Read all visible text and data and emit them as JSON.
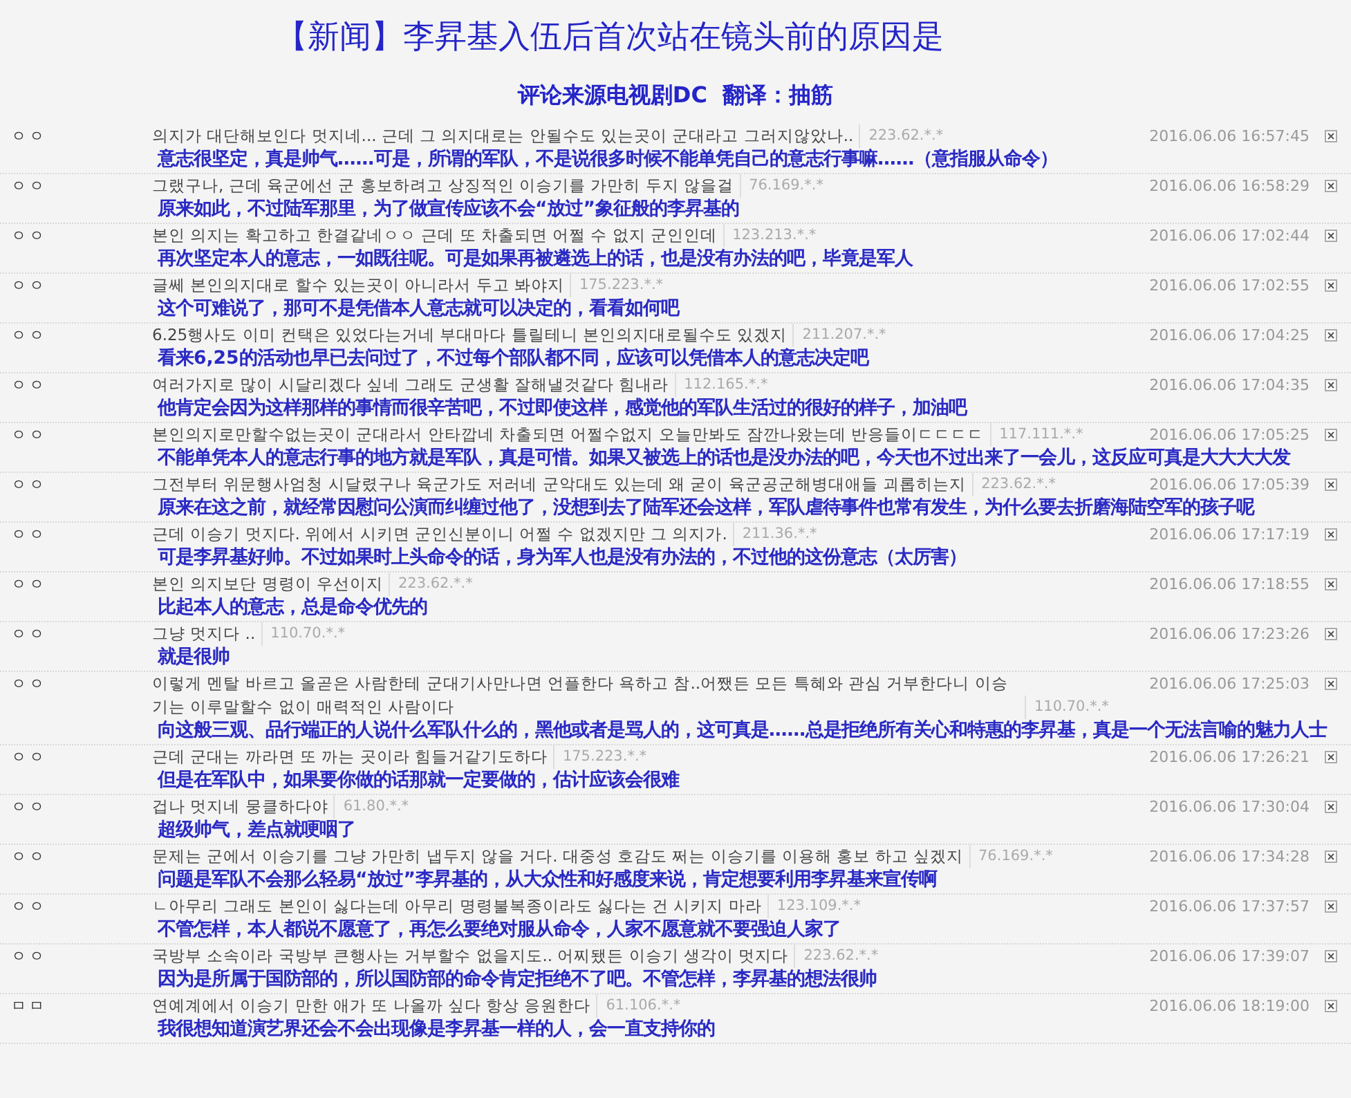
{
  "title": "【新闻】李昇基入伍后首次站在镜头前的原因是",
  "subtitle": "评论来源电视剧DC  翻译：抽筋",
  "comments": [
    {
      "name": "ㅇㅇ",
      "text": "의지가 대단해보인다 멋지네... 근데 그 의지대로는 안될수도 있는곳이 군대라고 그러지않았나..",
      "ip": "223.62.*.*",
      "date": "2016.06.06 16:57:45",
      "translation": "意志很坚定，真是帅气……可是，所谓的军队，不是说很多时候不能单凭自己的意志行事嘛……（意指服从命令）"
    },
    {
      "name": "ㅇㅇ",
      "text": "그랬구나, 근데 육군에선 군 홍보하려고 상징적인 이승기를 가만히 두지 않을걸",
      "ip": "76.169.*.*",
      "date": "2016.06.06 16:58:29",
      "translation": "原来如此，不过陆军那里，为了做宣传应该不会“放过”象征般的李昇基的"
    },
    {
      "name": "ㅇㅇ",
      "text": "본인 의지는 확고하고 한결같네ㅇㅇ 근데 또 차출되면 어쩔 수 없지 군인인데",
      "ip": "123.213.*.*",
      "date": "2016.06.06 17:02:44",
      "translation": "再次坚定本人的意志，一如既往呢。可是如果再被遴选上的话，也是没有办法的吧，毕竟是军人"
    },
    {
      "name": "ㅇㅇ",
      "text": "글쎄 본인의지대로 할수 있는곳이 아니라서 두고 봐야지",
      "ip": "175.223.*.*",
      "date": "2016.06.06 17:02:55",
      "translation": "这个可难说了，那可不是凭借本人意志就可以决定的，看看如何吧"
    },
    {
      "name": "ㅇㅇ",
      "text": "6.25행사도 이미 컨택은 있었다는거네 부대마다 틀릴테니 본인의지대로될수도 있겠지",
      "ip": "211.207.*.*",
      "date": "2016.06.06 17:04:25",
      "translation": "看来6,25的活动也早已去问过了，不过每个部队都不同，应该可以凭借本人的意志决定吧"
    },
    {
      "name": "ㅇㅇ",
      "text": "여러가지로 많이 시달리겠다 싶네 그래도 군생활 잘해낼것같다 힘내라",
      "ip": "112.165.*.*",
      "date": "2016.06.06 17:04:35",
      "translation": "他肯定会因为这样那样的事情而很辛苦吧，不过即使这样，感觉他的军队生活过的很好的样子，加油吧"
    },
    {
      "name": "ㅇㅇ",
      "text": "본인의지로만할수없는곳이 군대라서 안타깝네 차출되면 어쩔수없지 오늘만봐도 잠깐나왔는데 반응들이ㄷㄷㄷㄷ",
      "ip": "117.111.*.*",
      "date": "2016.06.06 17:05:25",
      "translation": "不能单凭本人的意志行事的地方就是军队，真是可惜。如果又被选上的话也是没办法的吧，今天也不过出来了一会儿，这反应可真是大大大大发"
    },
    {
      "name": "ㅇㅇ",
      "text": "그전부터 위문행사엄청 시달렸구나 육군가도 저러네 군악대도 있는데 왜 굳이 육군공군해병대애들 괴롭히는지",
      "ip": "223.62.*.*",
      "date": "2016.06.06 17:05:39",
      "translation": "原来在这之前，就经常因慰问公演而纠缠过他了，没想到去了陆军还会这样，军队虐待事件也常有发生，为什么要去折磨海陆空军的孩子呢"
    },
    {
      "name": "ㅇㅇ",
      "text": "근데 이승기 멋지다. 위에서 시키면 군인신분이니 어쩔 수 없겠지만 그 의지가.",
      "ip": "211.36.*.*",
      "date": "2016.06.06 17:17:19",
      "translation": "可是李昇基好帅。不过如果时上头命令的话，身为军人也是没有办法的，不过他的这份意志（太厉害）"
    },
    {
      "name": "ㅇㅇ",
      "text": "본인 의지보단 명령이 우선이지",
      "ip": "223.62.*.*",
      "date": "2016.06.06 17:18:55",
      "translation": "比起本人的意志，总是命令优先的"
    },
    {
      "name": "ㅇㅇ",
      "text": "그냥 멋지다 ..",
      "ip": "110.70.*.*",
      "date": "2016.06.06 17:23:26",
      "translation": "就是很帅"
    },
    {
      "name": "ㅇㅇ",
      "text": "이렇게 멘탈 바르고 올곧은 사람한테 군대기사만나면 언플한다 욕하고 참..어쨌든 모든 특혜와 관심 거부한다니 이승기는 이루말할수 없이 매력적인 사람이다",
      "ip": "110.70.*.*",
      "date": "2016.06.06 17:25:03",
      "translation": "向这般三观、品行端正的人说什么军队什么的，黑他或者是骂人的，这可真是……总是拒绝所有关心和特惠的李昇基，真是一个无法言喻的魅力人士"
    },
    {
      "name": "ㅇㅇ",
      "text": "근데 군대는 까라면 또 까는 곳이라 힘들거같기도하다",
      "ip": "175.223.*.*",
      "date": "2016.06.06 17:26:21",
      "translation": "但是在军队中，如果要你做的话那就一定要做的，估计应该会很难"
    },
    {
      "name": "ㅇㅇ",
      "text": "겁나 멋지네 뭉클하다야",
      "ip": "61.80.*.*",
      "date": "2016.06.06 17:30:04",
      "translation": "超级帅气，差点就哽咽了"
    },
    {
      "name": "ㅇㅇ",
      "text": "문제는 군에서 이승기를 그냥 가만히 냅두지 않을 거다. 대중성 호감도 쩌는 이승기를 이용해 홍보 하고 싶겠지",
      "ip": "76.169.*.*",
      "date": "2016.06.06 17:34:28",
      "translation": "问题是军队不会那么轻易“放过”李昇基的，从大众性和好感度来说，肯定想要利用李昇基来宣传啊"
    },
    {
      "name": "ㅇㅇ",
      "text": "ㄴ아무리 그래도 본인이 싫다는데 아무리 명령불복종이라도 싫다는 건 시키지 마라",
      "ip": "123.109.*.*",
      "date": "2016.06.06 17:37:57",
      "translation": "不管怎样，本人都说不愿意了，再怎么要绝对服从命令，人家不愿意就不要强迫人家了"
    },
    {
      "name": "ㅇㅇ",
      "text": "국방부 소속이라 국방부 큰행사는 거부할수 없을지도.. 어찌됐든 이승기 생각이 멋지다",
      "ip": "223.62.*.*",
      "date": "2016.06.06 17:39:07",
      "translation": "因为是所属于国防部的，所以国防部的命令肯定拒绝不了吧。不管怎样，李昇基的想法很帅"
    },
    {
      "name": "ㅁㅁ",
      "text": "연예계에서 이승기 만한 애가 또 나올까 싶다 항상 응원한다",
      "ip": "61.106.*.*",
      "date": "2016.06.06 18:19:00",
      "translation": "我很想知道演艺界还会不会出现像是李昇基一样的人，会一直支持你的"
    }
  ]
}
